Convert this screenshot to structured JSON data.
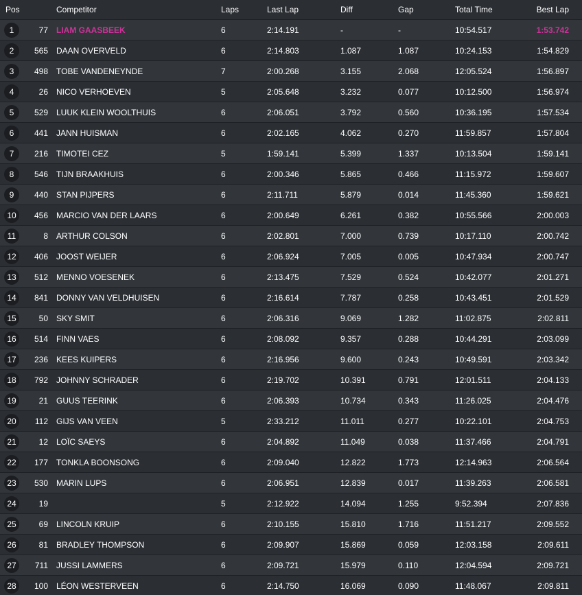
{
  "headers": {
    "pos": "Pos",
    "competitor": "Competitor",
    "laps": "Laps",
    "last_lap": "Last Lap",
    "diff": "Diff",
    "gap": "Gap",
    "total_time": "Total Time",
    "best_lap": "Best Lap"
  },
  "accent_color": "#cc3399",
  "rows": [
    {
      "pos": "1",
      "num": "77",
      "name": "LIAM GAASBEEK",
      "laps": "6",
      "last": "2:14.191",
      "diff": "-",
      "gap": "-",
      "total": "10:54.517",
      "best": "1:53.742"
    },
    {
      "pos": "2",
      "num": "565",
      "name": "DAAN OVERVELD",
      "laps": "6",
      "last": "2:14.803",
      "diff": "1.087",
      "gap": "1.087",
      "total": "10:24.153",
      "best": "1:54.829"
    },
    {
      "pos": "3",
      "num": "498",
      "name": "TOBE VANDENEYNDE",
      "laps": "7",
      "last": "2:00.268",
      "diff": "3.155",
      "gap": "2.068",
      "total": "12:05.524",
      "best": "1:56.897"
    },
    {
      "pos": "4",
      "num": "26",
      "name": "NICO VERHOEVEN",
      "laps": "5",
      "last": "2:05.648",
      "diff": "3.232",
      "gap": "0.077",
      "total": "10:12.500",
      "best": "1:56.974"
    },
    {
      "pos": "5",
      "num": "529",
      "name": "LUUK KLEIN WOOLTHUIS",
      "laps": "6",
      "last": "2:06.051",
      "diff": "3.792",
      "gap": "0.560",
      "total": "10:36.195",
      "best": "1:57.534"
    },
    {
      "pos": "6",
      "num": "441",
      "name": "JANN HUISMAN",
      "laps": "6",
      "last": "2:02.165",
      "diff": "4.062",
      "gap": "0.270",
      "total": "11:59.857",
      "best": "1:57.804"
    },
    {
      "pos": "7",
      "num": "216",
      "name": "TIMOTEI CEZ",
      "laps": "5",
      "last": "1:59.141",
      "diff": "5.399",
      "gap": "1.337",
      "total": "10:13.504",
      "best": "1:59.141"
    },
    {
      "pos": "8",
      "num": "546",
      "name": "TIJN BRAAKHUIS",
      "laps": "6",
      "last": "2:00.346",
      "diff": "5.865",
      "gap": "0.466",
      "total": "11:15.972",
      "best": "1:59.607"
    },
    {
      "pos": "9",
      "num": "440",
      "name": "STAN PIJPERS",
      "laps": "6",
      "last": "2:11.711",
      "diff": "5.879",
      "gap": "0.014",
      "total": "11:45.360",
      "best": "1:59.621"
    },
    {
      "pos": "10",
      "num": "456",
      "name": "MARCIO VAN DER LAARS",
      "laps": "6",
      "last": "2:00.649",
      "diff": "6.261",
      "gap": "0.382",
      "total": "10:55.566",
      "best": "2:00.003"
    },
    {
      "pos": "11",
      "num": "8",
      "name": "ARTHUR COLSON",
      "laps": "6",
      "last": "2:02.801",
      "diff": "7.000",
      "gap": "0.739",
      "total": "10:17.110",
      "best": "2:00.742"
    },
    {
      "pos": "12",
      "num": "406",
      "name": "JOOST WEIJER",
      "laps": "6",
      "last": "2:06.924",
      "diff": "7.005",
      "gap": "0.005",
      "total": "10:47.934",
      "best": "2:00.747"
    },
    {
      "pos": "13",
      "num": "512",
      "name": "MENNO VOESENEK",
      "laps": "6",
      "last": "2:13.475",
      "diff": "7.529",
      "gap": "0.524",
      "total": "10:42.077",
      "best": "2:01.271"
    },
    {
      "pos": "14",
      "num": "841",
      "name": "DONNY VAN VELDHUISEN",
      "laps": "6",
      "last": "2:16.614",
      "diff": "7.787",
      "gap": "0.258",
      "total": "10:43.451",
      "best": "2:01.529"
    },
    {
      "pos": "15",
      "num": "50",
      "name": "SKY SMIT",
      "laps": "6",
      "last": "2:06.316",
      "diff": "9.069",
      "gap": "1.282",
      "total": "11:02.875",
      "best": "2:02.811"
    },
    {
      "pos": "16",
      "num": "514",
      "name": "FINN VAES",
      "laps": "6",
      "last": "2:08.092",
      "diff": "9.357",
      "gap": "0.288",
      "total": "10:44.291",
      "best": "2:03.099"
    },
    {
      "pos": "17",
      "num": "236",
      "name": "KEES KUIPERS",
      "laps": "6",
      "last": "2:16.956",
      "diff": "9.600",
      "gap": "0.243",
      "total": "10:49.591",
      "best": "2:03.342"
    },
    {
      "pos": "18",
      "num": "792",
      "name": "JOHNNY SCHRADER",
      "laps": "6",
      "last": "2:19.702",
      "diff": "10.391",
      "gap": "0.791",
      "total": "12:01.511",
      "best": "2:04.133"
    },
    {
      "pos": "19",
      "num": "21",
      "name": "GUUS TEERINK",
      "laps": "6",
      "last": "2:06.393",
      "diff": "10.734",
      "gap": "0.343",
      "total": "11:26.025",
      "best": "2:04.476"
    },
    {
      "pos": "20",
      "num": "112",
      "name": "GIJS VAN VEEN",
      "laps": "5",
      "last": "2:33.212",
      "diff": "11.011",
      "gap": "0.277",
      "total": "10:22.101",
      "best": "2:04.753"
    },
    {
      "pos": "21",
      "num": "12",
      "name": "LOÏC SAEYS",
      "laps": "6",
      "last": "2:04.892",
      "diff": "11.049",
      "gap": "0.038",
      "total": "11:37.466",
      "best": "2:04.791"
    },
    {
      "pos": "22",
      "num": "177",
      "name": "TONKLA BOONSONG",
      "laps": "6",
      "last": "2:09.040",
      "diff": "12.822",
      "gap": "1.773",
      "total": "12:14.963",
      "best": "2:06.564"
    },
    {
      "pos": "23",
      "num": "530",
      "name": "MARIN LUPS",
      "laps": "6",
      "last": "2:06.951",
      "diff": "12.839",
      "gap": "0.017",
      "total": "11:39.263",
      "best": "2:06.581"
    },
    {
      "pos": "24",
      "num": "19",
      "name": "",
      "laps": "5",
      "last": "2:12.922",
      "diff": "14.094",
      "gap": "1.255",
      "total": "9:52.394",
      "best": "2:07.836"
    },
    {
      "pos": "25",
      "num": "69",
      "name": "LINCOLN KRUIP",
      "laps": "6",
      "last": "2:10.155",
      "diff": "15.810",
      "gap": "1.716",
      "total": "11:51.217",
      "best": "2:09.552"
    },
    {
      "pos": "26",
      "num": "81",
      "name": "BRADLEY THOMPSON",
      "laps": "6",
      "last": "2:09.907",
      "diff": "15.869",
      "gap": "0.059",
      "total": "12:03.158",
      "best": "2:09.611"
    },
    {
      "pos": "27",
      "num": "711",
      "name": "JUSSI LAMMERS",
      "laps": "6",
      "last": "2:09.721",
      "diff": "15.979",
      "gap": "0.110",
      "total": "12:04.594",
      "best": "2:09.721"
    },
    {
      "pos": "28",
      "num": "100",
      "name": "LÉON WESTERVEEN",
      "laps": "6",
      "last": "2:14.750",
      "diff": "16.069",
      "gap": "0.090",
      "total": "11:48.067",
      "best": "2:09.811"
    }
  ]
}
